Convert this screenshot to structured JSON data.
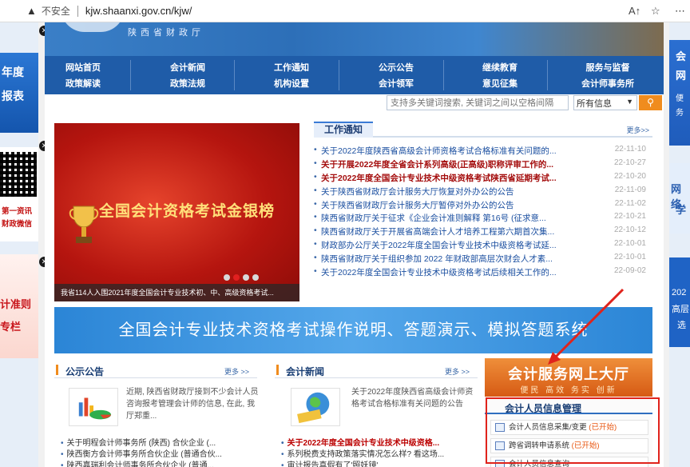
{
  "browser": {
    "warning_icon": "warning-triangle-icon",
    "insecure_label": "不安全",
    "url": "kjw.shaanxi.gov.cn/kjw/"
  },
  "header": {
    "site_name": "陕西省财政厅"
  },
  "nav": [
    "网站首页",
    "会计新闻",
    "工作通知",
    "公示公告",
    "继续教育",
    "服务与监督",
    "政策解读",
    "政策法规",
    "机构设置",
    "会计领军",
    "意见征集",
    "会计师事务所"
  ],
  "search": {
    "placeholder": "支持多关键词搜索, 关键词之间以空格间隔",
    "scope": "所有信息",
    "button_icon": "search-icon"
  },
  "slideshow": {
    "title": "全国会计资格考试金银榜",
    "caption": "我省114人入围2021年度全国会计专业技术初、中、高级资格考试..."
  },
  "notice": {
    "title": "工作通知",
    "more": "更多>>",
    "items": [
      {
        "text": "关于2022年度陕西省高级会计师资格考试合格标准有关问题的...",
        "date": "22-11-10",
        "emphasis": false
      },
      {
        "text": "关于开展2022年度全省会计系列高级(正高级)职称评审工作的...",
        "date": "22-10-27",
        "emphasis": true
      },
      {
        "text": "关于2022年度全国会计专业技术中级资格考试陕西省延期考试...",
        "date": "22-10-20",
        "emphasis": true
      },
      {
        "text": "关于陕西省财政厅会计服务大厅恢复对外办公的公告",
        "date": "22-11-09",
        "emphasis": false
      },
      {
        "text": "关于陕西省财政厅会计服务大厅暂停对外办公的公告",
        "date": "22-11-02",
        "emphasis": false
      },
      {
        "text": "陕西省财政厅关于征求《企业会计准则解释 第16号 (征求意...",
        "date": "22-10-21",
        "emphasis": false
      },
      {
        "text": "陕西省财政厅关于开展省高端会计人才培养工程第六期首次集...",
        "date": "22-10-12",
        "emphasis": false
      },
      {
        "text": "财政部办公厅关于2022年度全国会计专业技术中级资格考试延...",
        "date": "22-10-01",
        "emphasis": false
      },
      {
        "text": "陕西省财政厅关于组织参加 2022 年财政部高层次财会人才素...",
        "date": "22-10-01",
        "emphasis": false
      },
      {
        "text": "关于2022年度全国会计专业技术中级资格考试后续相关工作的...",
        "date": "22-09-02",
        "emphasis": false
      }
    ]
  },
  "banner": {
    "text": "全国会计专业技术资格考试操作说明、答题演示、模拟答题系统"
  },
  "announcements": {
    "title": "公示公告",
    "more": "更多 >>",
    "summary": "近期, 陕西省财政厅接到不少会计人员咨询报考管理会计师的信息, 在此, 我厅郑重...",
    "items": [
      "关于明程会计师事务所 (陕西) 合伙企业 (...",
      "陕西衡方会计师事务所合伙企业 (普通合伙...",
      "陕西嘉瑞利会计师事务所合伙企业 (普通..."
    ]
  },
  "news": {
    "title": "会计新闻",
    "more": "更多 >>",
    "summary": "关于2022年度陕西省高级会计师资格考试合格标准有关问题的公告",
    "items": [
      "关于2022年度全国会计专业技术中级资格...",
      "系列税费支持政策落实情况怎么样? 看这场...",
      "审计报告真假有了'照妖镜'"
    ]
  },
  "service_hall": {
    "title": "会计服务网上大厅",
    "subtitle": "便民 高效 务实 创新",
    "section_title": "会计人员信息管理",
    "items": [
      {
        "label": "会计人员信息采集/变更",
        "status": "(已开始)"
      },
      {
        "label": "跨省调转申请系统",
        "status": "(已开始)"
      },
      {
        "label": "会计人员信息查询",
        "status": ""
      }
    ]
  },
  "left_ads": {
    "ad1_line1": "年度",
    "ad1_line2": "报表",
    "ad2_line1": "第一资讯",
    "ad2_line2": "财政微信",
    "ad3_line1": "计准则",
    "ad3_line2": "专栏"
  },
  "right_ads": {
    "ad1_line1": "会",
    "ad1_line2": "网",
    "ad1_line3": "便",
    "ad1_line4": "务",
    "ad2_line1": "网络",
    "ad2_line2": "学",
    "ad3_line1": "202",
    "ad3_line2": "高层",
    "ad3_line3": "选"
  },
  "colors": {
    "nav_bg": "#1f5ca8",
    "accent_orange": "#f08c1e",
    "emphasis_red": "#a40d0d",
    "link_blue": "#1b4fa0",
    "annotation_red": "#e0231c"
  }
}
